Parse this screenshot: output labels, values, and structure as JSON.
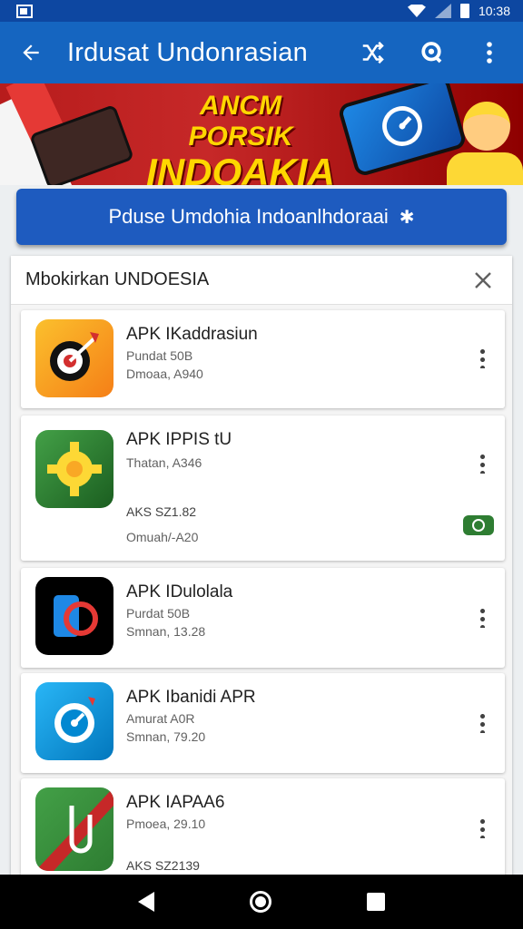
{
  "status_bar": {
    "time": "10:38",
    "icons": [
      "notification-icon",
      "wifi-icon",
      "signal-icon",
      "battery-icon"
    ]
  },
  "app_bar": {
    "title": "Irdusat Undonrasian",
    "actions": [
      "share-icon",
      "search-icon",
      "more-vert-icon"
    ]
  },
  "banner": {
    "headline_line1": "ANCM PORSIK",
    "headline_line2": "INDOAKIA"
  },
  "primary_button": {
    "label": "Pduse Umdohia Indoanlhdoraai"
  },
  "list_panel": {
    "title": "Mbokirkan UNDOESIA",
    "items": [
      {
        "name": "APK IKaddrasiun",
        "line1": "Pundat 50B",
        "line2": "Dmoaa, A940",
        "icon": "target-app-icon",
        "colors": [
          "#fbc02d",
          "#f57f17"
        ]
      },
      {
        "name": "APK IPPIS tU",
        "line1": "Thatan, A346",
        "line2": "AKS SZ1.82",
        "line3": "Omuah/-A20",
        "icon": "gear-app-icon",
        "colors": [
          "#43a047",
          "#1b5e20"
        ],
        "badge": "toggle-on"
      },
      {
        "name": "APK IDulolala",
        "line1": "Purdat 50B",
        "line2": "Smnan, 13.28",
        "icon": "phone-app-icon",
        "colors": [
          "#000000",
          "#111111"
        ]
      },
      {
        "name": "APK Ibanidi APR",
        "line1": "Amurat A0R",
        "line2": "Smnan, 79.20",
        "icon": "compass-app-icon",
        "colors": [
          "#29b6f6",
          "#0277bd"
        ]
      },
      {
        "name": "APK IAPAA6",
        "line1": "Pmoea, 29.10",
        "line2": "AKS SZ2139",
        "icon": "paperclip-app-icon",
        "colors": [
          "#43a047",
          "#c62828"
        ]
      }
    ]
  },
  "theme": {
    "primary": "#1565c0",
    "primary_dark": "#0d47a1",
    "accent_green": "#2e7d32"
  }
}
